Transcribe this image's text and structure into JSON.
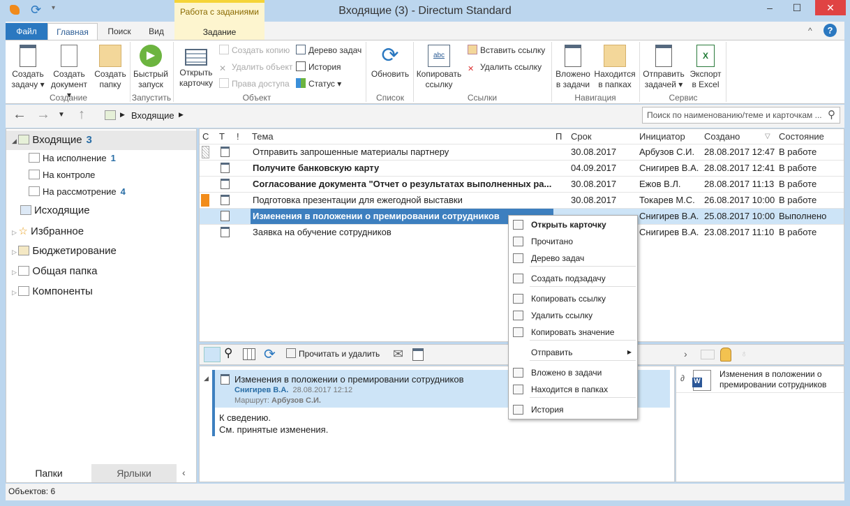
{
  "window": {
    "title": "Входящие (3) - Directum Standard",
    "minimize": "–",
    "maximize": "☐",
    "close": "✕"
  },
  "ribbon": {
    "context_tab_group": "Работа с заданиями",
    "tabs": [
      "Файл",
      "Главная",
      "Поиск",
      "Вид",
      "Задание"
    ],
    "help": "?",
    "collapse": "^",
    "buttons": {
      "create_task": "Создать задачу",
      "create_doc": "Создать документ",
      "create_folder": "Создать папку",
      "quick_run": "Быстрый запуск",
      "open_card": "Открыть карточку",
      "create_copy": "Создать копию",
      "delete_object": "Удалить объект",
      "access_rights": "Права доступа",
      "task_tree": "Дерево задач",
      "history": "История",
      "status": "Статус",
      "refresh": "Обновить",
      "copy_link": "Копировать ссылку",
      "paste_link": "Вставить ссылку",
      "delete_link": "Удалить ссылку",
      "attached_tasks": "Вложено в задачи",
      "in_folders": "Находится в папках",
      "send_task": "Отправить задачей",
      "export_excel": "Экспорт в Excel"
    },
    "groups": [
      "Создание",
      "Запустить",
      "Объект",
      "Список",
      "Ссылки",
      "Навигация",
      "Сервис"
    ]
  },
  "nav": {
    "breadcrumb": "Входящие",
    "search_placeholder": "Поиск по наименованию/теме и карточкам ..."
  },
  "sidebar": {
    "items": [
      {
        "label": "Входящие",
        "count": "3"
      },
      {
        "label": "На исполнение",
        "count": "1"
      },
      {
        "label": "На контроле",
        "count": ""
      },
      {
        "label": "На рассмотрение",
        "count": "4"
      },
      {
        "label": "Исходящие"
      },
      {
        "label": "Избранное"
      },
      {
        "label": "Бюджетирование"
      },
      {
        "label": "Общая папка"
      },
      {
        "label": "Компоненты"
      }
    ],
    "tabs": [
      "Папки",
      "Ярлыки"
    ]
  },
  "grid": {
    "columns": [
      "С",
      "Т",
      "!",
      "Тема",
      "П",
      "Срок",
      "Инициатор",
      "Создано",
      "Состояние"
    ],
    "rows": [
      {
        "subject": "Отправить запрошенные материалы партнеру",
        "due": "30.08.2017",
        "initiator": "Арбузов С.И.",
        "created": "28.08.2017 12:47",
        "state": "В работе",
        "bold": false,
        "mark": "hatched",
        "icon": "task-done"
      },
      {
        "subject": "Получите банковскую карту",
        "due": "04.09.2017",
        "initiator": "Снигирев В.А.",
        "created": "28.08.2017 12:41",
        "state": "В работе",
        "bold": true,
        "mark": "",
        "icon": "task"
      },
      {
        "subject": "Согласование документа \"Отчет о результатах выполненных ра...",
        "due": "30.08.2017",
        "initiator": "Ежов В.Л.",
        "created": "28.08.2017 11:13",
        "state": "В работе",
        "bold": true,
        "mark": "",
        "icon": "task"
      },
      {
        "subject": "Подготовка презентации для ежегодной выставки",
        "due": "30.08.2017",
        "initiator": "Токарев М.С.",
        "created": "26.08.2017 10:00",
        "state": "В работе",
        "bold": false,
        "mark": "#f28c1a",
        "icon": "task"
      },
      {
        "subject": "Изменения в положении о премировании сотрудников",
        "due": "",
        "initiator": "Снигирев В.А.",
        "created": "25.08.2017 10:00",
        "state": "Выполнено",
        "bold": true,
        "mark": "",
        "icon": "notice"
      },
      {
        "subject": "Заявка на обучение сотрудников",
        "due": "",
        "initiator": "Снигирев В.А.",
        "created": "23.08.2017 11:10",
        "state": "В работе",
        "bold": false,
        "mark": "",
        "icon": "task"
      }
    ]
  },
  "context_menu": {
    "items": [
      "Открыть карточку",
      "Прочитано",
      "Дерево задач",
      "Создать подзадачу",
      "Копировать ссылку",
      "Удалить ссылку",
      "Копировать значение",
      "Отправить",
      "Вложено в задачи",
      "Находится в папках",
      "История"
    ]
  },
  "bottom_toolbar": {
    "read_delete": "Прочитать и удалить"
  },
  "preview": {
    "subject": "Изменения в положении о премировании сотрудников",
    "author": "Снигирев В.А.",
    "date": "28.08.2017 12:12",
    "route_label": "Маршрут:",
    "route": "Арбузов С.И.",
    "body": [
      "К сведению.",
      "См. принятые изменения."
    ]
  },
  "attachments": [
    {
      "name": "Изменения в положении о премировании сотрудников"
    }
  ],
  "status": {
    "objects": "Объектов: 6"
  },
  "colors": {
    "accent": "#2b78c0",
    "selection": "#cde4f7",
    "highlight": "#3d7fbf",
    "context_tab": "#fdf5cf"
  }
}
